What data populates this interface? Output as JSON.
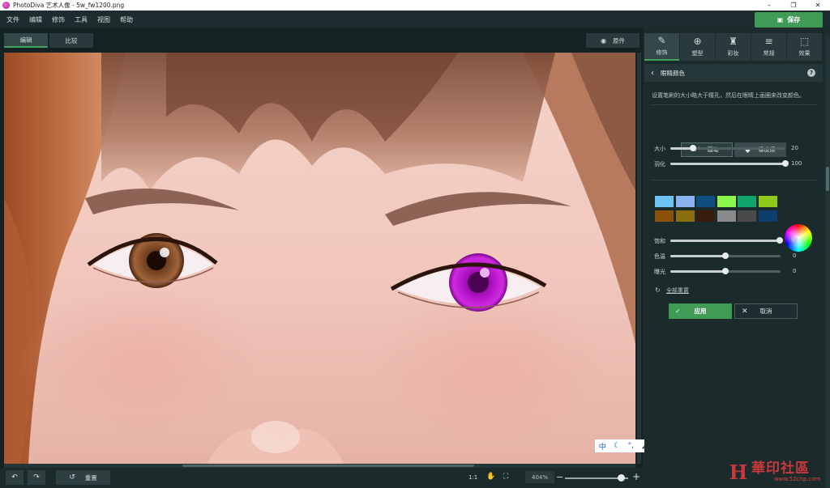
{
  "window": {
    "title": "PhotoDiva 艺术人像 - 5w_fw1200.png",
    "controls": [
      "–",
      "❐",
      "✕"
    ]
  },
  "menu": [
    "文件",
    "编辑",
    "修饰",
    "工具",
    "视图",
    "帮助"
  ],
  "save_label": "保存",
  "view_tabs": [
    "编辑",
    "比较"
  ],
  "original_label": "原件",
  "bottom": {
    "reset_label": "重置",
    "ratio_label": "1:1",
    "zoom_value": "404%",
    "zoom_minus": "−",
    "zoom_plus": "+",
    "zoom_level": 0.88
  },
  "ime": [
    "中",
    "☾",
    "°,",
    "🎤",
    "👤",
    "▦"
  ],
  "tool_tabs": [
    {
      "label": "修饰",
      "icon": "retouch-icon",
      "glyph": "✎"
    },
    {
      "label": "塑型",
      "icon": "reshape-icon",
      "glyph": "⊕"
    },
    {
      "label": "彩妆",
      "icon": "makeup-icon",
      "glyph": "♜"
    },
    {
      "label": "常规",
      "icon": "sliders-icon",
      "glyph": "≡"
    },
    {
      "label": "效果",
      "icon": "effects-icon",
      "glyph": "⬚"
    }
  ],
  "section": {
    "title": "眼睛颜色",
    "help": "?"
  },
  "description": "设置笔刷的大小略大于瞳孔，然后在眼睛上画圈来改变颜色。",
  "brush_tools": {
    "brush_label": "画笔",
    "eraser_label": "橡皮擦"
  },
  "sliders": [
    {
      "label": "大小",
      "value": "20",
      "level": 0.2
    },
    {
      "label": "羽化",
      "value": "100",
      "level": 1.0
    }
  ],
  "swatches": [
    "#6cc4f4",
    "#8ab2f0",
    "#0e4f7e",
    "#8cf54a",
    "#10a36c",
    "#8fc91a",
    "#8a5208",
    "#8a6e0e",
    "#3a1c0e",
    "#8a8a8a",
    "#4a4a4a",
    "#0d3f6e"
  ],
  "color_sliders": [
    {
      "label": "饱和",
      "value": "99",
      "level": 0.99
    },
    {
      "label": "色温",
      "value": "0",
      "level": 0.5
    },
    {
      "label": "曝光",
      "value": "0",
      "level": 0.5
    }
  ],
  "reset_all_label": "全部重置",
  "apply_label": "应用",
  "cancel_label": "取消",
  "watermark": {
    "name": "華印社區",
    "url": "www.52cnp.com"
  },
  "colors": {
    "accent": "#3f9b55",
    "panel_bg": "#1b2a2b",
    "eye_recolor": "#b012c4"
  }
}
